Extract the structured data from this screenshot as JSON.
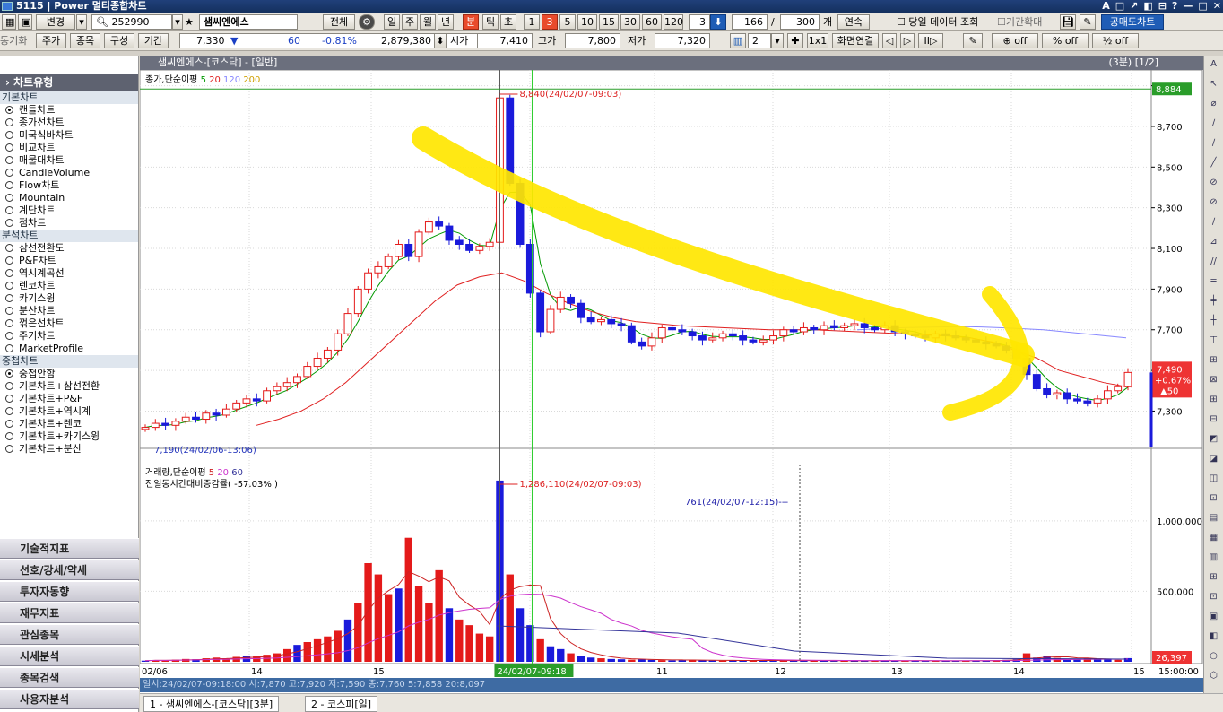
{
  "titlebar": {
    "title": "5115 | Power 멀티종합차트",
    "controls": [
      "A",
      "□",
      "↗",
      "◧",
      "⊟",
      "?",
      "—",
      "□",
      "✕"
    ]
  },
  "toolbar1": {
    "mode": "변경",
    "code": "252990",
    "name": "샘씨엔에스",
    "all": "전체",
    "periods": [
      "일",
      "주",
      "월",
      "년",
      "분",
      "틱",
      "초"
    ],
    "active_period": "분",
    "minutes": [
      "1",
      "3",
      "5",
      "10",
      "15",
      "30",
      "60",
      "120"
    ],
    "active_minute": "3",
    "count_a": "3",
    "count_b": "166",
    "count_c": "300",
    "count_unit": "개",
    "series_btn": "연속",
    "same_day_label": "당일 데이터 조회",
    "range_zoom": "기간확대",
    "short_chart": "공매도차트"
  },
  "toolbar2": {
    "sync": "동기화",
    "b1": "주가",
    "b2": "종목",
    "b3": "구성",
    "b4": "기간",
    "price": "7,330",
    "arrow": "▼",
    "change": "60",
    "rate": "-0.81%",
    "volume": "2,879,380",
    "open_label": "시가",
    "open": "7,410",
    "high_label": "고가",
    "high": "7,800",
    "low_label": "저가",
    "low": "7,320",
    "layout_num": "2",
    "zoom": "1x1",
    "screen_link": "화면연결",
    "off1": "off",
    "off2": "off",
    "off3": "off"
  },
  "sidebar": {
    "header": "차트유형",
    "sections": [
      {
        "title": "기본차트",
        "items": [
          {
            "label": "캔들차트",
            "selected": true
          },
          {
            "label": "종가선차트"
          },
          {
            "label": "미국식바차트"
          },
          {
            "label": "비교차트"
          },
          {
            "label": "매물대차트"
          },
          {
            "label": "CandleVolume"
          },
          {
            "label": "Flow차트"
          },
          {
            "label": "Mountain"
          },
          {
            "label": "계단차트"
          },
          {
            "label": "점차트"
          }
        ]
      },
      {
        "title": "분석차트",
        "items": [
          {
            "label": "삼선전환도"
          },
          {
            "label": "P&F차트"
          },
          {
            "label": "역시계곡선"
          },
          {
            "label": "렌코차트"
          },
          {
            "label": "카기스윙"
          },
          {
            "label": "분산차트"
          },
          {
            "label": "꺾은선차트"
          },
          {
            "label": "주기차트"
          },
          {
            "label": "MarketProfile"
          }
        ]
      },
      {
        "title": "중첩차트",
        "items": [
          {
            "label": "중첩안함",
            "selected": true
          },
          {
            "label": "기본차트+삼선전환"
          },
          {
            "label": "기본차트+P&F"
          },
          {
            "label": "기본차트+역시계"
          },
          {
            "label": "기본차트+렌코"
          },
          {
            "label": "기본차트+카기스윙"
          },
          {
            "label": "기본차트+분산"
          }
        ]
      }
    ],
    "bottom_buttons": [
      "기술적지표",
      "선호/강세/약세",
      "투자자동향",
      "재무지표",
      "관심종목",
      "시세분석",
      "종목검색",
      "사용자분석"
    ]
  },
  "chart_window": {
    "title": "샘씨엔에스-[코스닥] - [일반]",
    "page": "(3분) [1/2]"
  },
  "chart_data": [
    {
      "type": "candlestick",
      "title": "종가,단순이평",
      "ma_periods": [
        "5",
        "20",
        "120",
        "200"
      ],
      "ma_colors": [
        "#009900",
        "#e02020",
        "#8888ff",
        "#d0a000"
      ],
      "y_ticks": [
        8900,
        8700,
        8500,
        8300,
        8100,
        7900,
        7700,
        7500,
        7300
      ],
      "ylim": [
        7130,
        8960
      ],
      "x_ticks": [
        "02/06",
        "14",
        "15",
        "10",
        "11",
        "12",
        "13",
        "14",
        "15"
      ],
      "max_label": "8,840(24/02/07-09:03)",
      "min_label": "7,190(24/02/06-13:06)",
      "max_value": 8840,
      "min_value": 7190,
      "crosshair_price": "8,884",
      "current_price": "7,490",
      "current_change_pct": "+0.67%",
      "current_change_amt": "▲50",
      "x_cursor_label": "24/02/07-09:18",
      "close_path": [
        7220,
        7240,
        7230,
        7250,
        7270,
        7260,
        7290,
        7280,
        7310,
        7340,
        7360,
        7350,
        7400,
        7420,
        7440,
        7470,
        7520,
        7560,
        7600,
        7680,
        7780,
        7900,
        7980,
        8010,
        8060,
        8120,
        8060,
        8180,
        8230,
        8210,
        8140,
        8120,
        8090,
        8110,
        8130,
        8840,
        8420,
        8120,
        7880,
        7690,
        7800,
        7860,
        7830,
        7760,
        7740,
        7750,
        7730,
        7720,
        7640,
        7620,
        7660,
        7710,
        7700,
        7690,
        7670,
        7650,
        7660,
        7680,
        7670,
        7650,
        7640,
        7650,
        7670,
        7700,
        7690,
        7710,
        7700,
        7720,
        7710,
        7720,
        7730,
        7710,
        7700,
        7720,
        7690,
        7680,
        7670,
        7660,
        7680,
        7670,
        7660,
        7650,
        7640,
        7630,
        7620,
        7600,
        7560,
        7480,
        7410,
        7380,
        7390,
        7360,
        7350,
        7340,
        7360,
        7400,
        7420,
        7490
      ],
      "ma20_path": [
        7230,
        7260,
        7300,
        7360,
        7440,
        7540,
        7640,
        7740,
        7840,
        7920,
        7960,
        7980,
        7940,
        7880,
        7830,
        7790,
        7760,
        7740,
        7730,
        7720,
        7715,
        7710,
        7705,
        7700,
        7700,
        7700,
        7695,
        7690,
        7685,
        7680,
        7675,
        7670,
        7660,
        7640,
        7600,
        7560,
        7500,
        7470,
        7440,
        7420
      ],
      "ma120_path": [
        7700,
        7705,
        7710,
        7712,
        7714,
        7716,
        7714,
        7710,
        7705,
        7700,
        7690,
        7680,
        7670,
        7660
      ]
    },
    {
      "type": "bar",
      "title": "거래량,단순이평",
      "ma_periods": [
        "5",
        "20",
        "60"
      ],
      "subtitle": "전일동시간대비증감률( -57.03% )",
      "y_ticks": [
        1000000,
        500000
      ],
      "ylim": [
        0,
        1400000
      ],
      "max_label": "1,286,110(24/02/07-09:03)",
      "max_value": 1286110,
      "marker_label": "761(24/02/07-12:15)---",
      "current_volume": "26,397",
      "time_label": "15:00:00",
      "bars_k": [
        8,
        12,
        10,
        15,
        20,
        18,
        25,
        30,
        22,
        35,
        40,
        38,
        50,
        60,
        90,
        120,
        140,
        160,
        180,
        220,
        300,
        420,
        700,
        620,
        480,
        520,
        880,
        540,
        420,
        650,
        380,
        300,
        260,
        200,
        180,
        1286,
        620,
        380,
        260,
        160,
        110,
        90,
        60,
        40,
        30,
        25,
        20,
        18,
        15,
        18,
        14,
        12,
        10,
        12,
        14,
        10,
        9,
        8,
        10,
        12,
        9,
        8,
        7,
        10,
        8,
        9,
        8,
        7,
        6,
        8,
        7,
        6,
        8,
        10,
        9,
        8,
        7,
        6,
        8,
        7,
        6,
        8,
        9,
        10,
        12,
        14,
        18,
        60,
        30,
        40,
        28,
        22,
        20,
        25,
        18,
        16,
        14,
        26
      ]
    }
  ],
  "statusbar": {
    "text": "일시:24/02/07-09:18:00  시:7,870  고:7,920  저:7,590  종:7,760  5:7,858  20:8,097"
  },
  "tabs": [
    "1 - 샘씨엔에스-[코스닥][3분]",
    "2 - 코스피[일]"
  ]
}
